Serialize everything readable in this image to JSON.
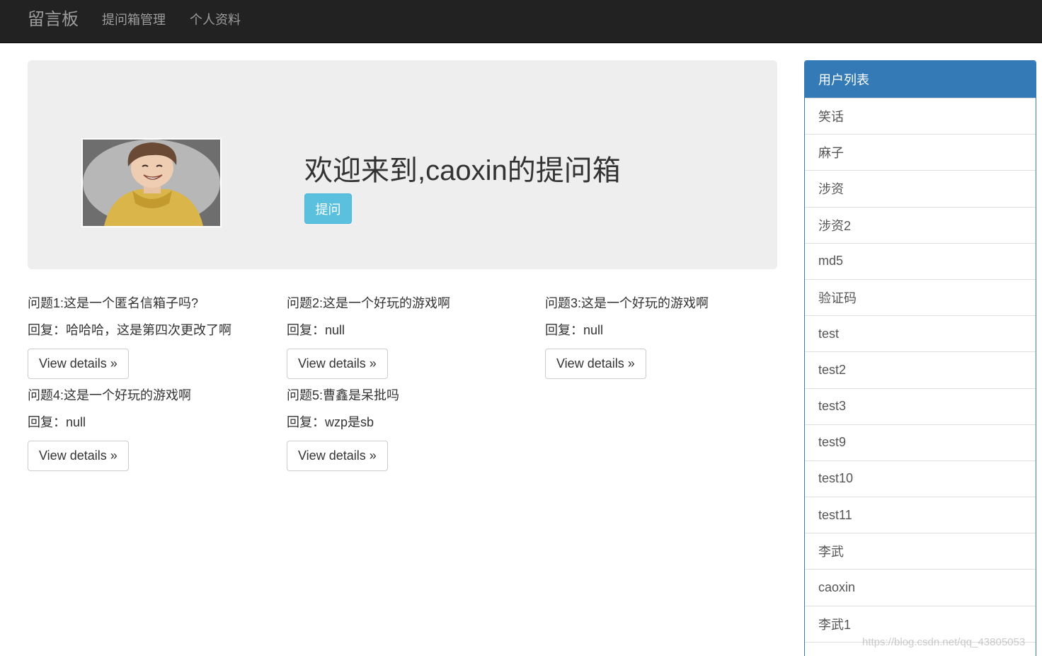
{
  "navbar": {
    "brand": "留言板",
    "links": [
      "提问箱管理",
      "个人资料"
    ]
  },
  "jumbotron": {
    "welcome": "欢迎来到,caoxin的提问箱",
    "ask_button": "提问"
  },
  "questions": [
    {
      "title": "问题1:这是一个匿名信箱子吗?",
      "reply": "回复：哈哈哈，这是第四次更改了啊",
      "button": "View details »"
    },
    {
      "title": "问题2:这是一个好玩的游戏啊",
      "reply": "回复：null",
      "button": "View details »"
    },
    {
      "title": "问题3:这是一个好玩的游戏啊",
      "reply": "回复：null",
      "button": "View details »"
    },
    {
      "title": "问题4:这是一个好玩的游戏啊",
      "reply": "回复：null",
      "button": "View details »"
    },
    {
      "title": "问题5:曹鑫是呆批吗",
      "reply": "回复：wzp是sb",
      "button": "View details »"
    }
  ],
  "user_panel": {
    "title": "用户列表",
    "users": [
      "笑话",
      "麻子",
      "涉资",
      "涉资2",
      "md5",
      "验证码",
      "test",
      "test2",
      "test3",
      "test9",
      "test10",
      "test11",
      "李武",
      "caoxin",
      "李武1",
      ""
    ]
  },
  "watermark": "https://blog.csdn.net/qq_43805053",
  "colors": {
    "navbar_bg": "#222222",
    "jumbotron_bg": "#eeeeee",
    "info_button": "#5bc0de",
    "panel_primary": "#337ab7"
  }
}
